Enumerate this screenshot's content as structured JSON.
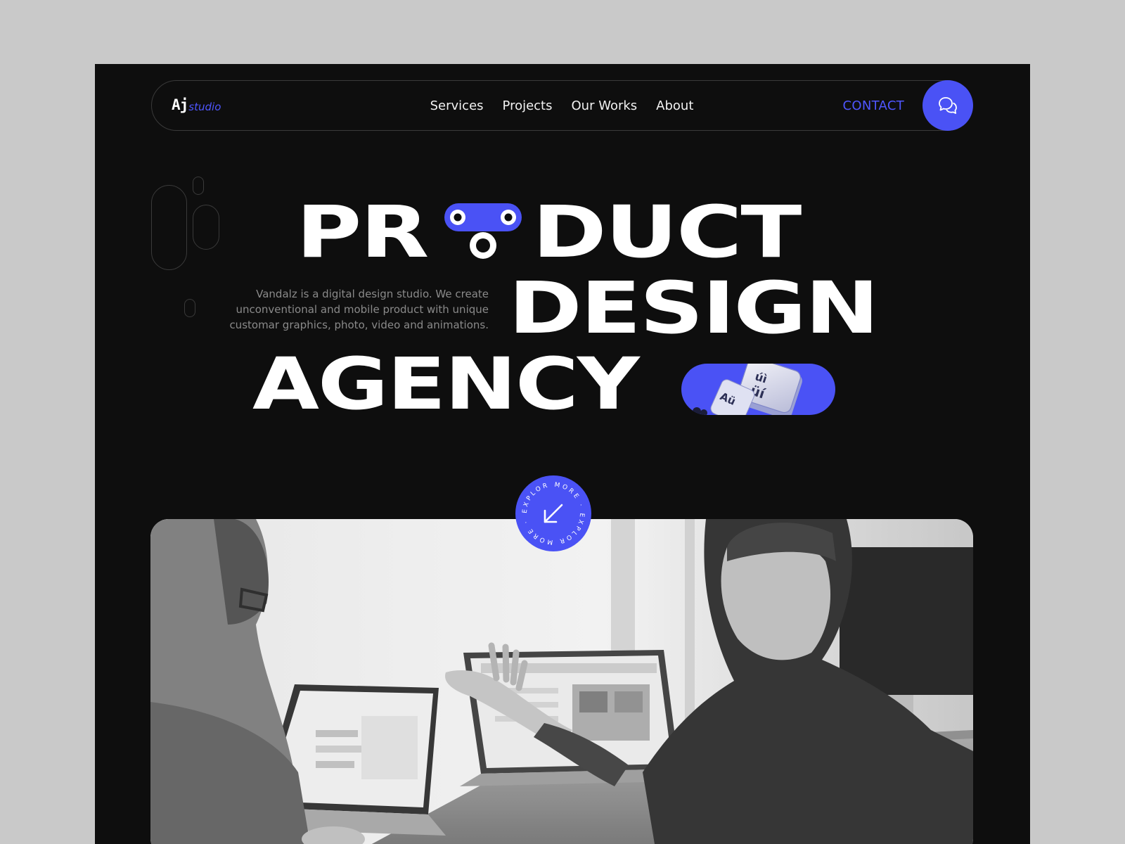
{
  "nav": {
    "logo_mark": "Aj",
    "logo_word": "studio",
    "links": [
      "Services",
      "Projects",
      "Our Works",
      "About"
    ],
    "contact": "CONTACT"
  },
  "hero": {
    "line1_left": "PR",
    "line1_right": "DUCT",
    "line2": "DESIGN",
    "line3": "AGENCY",
    "description": "Vandalz is a digital design studio. We create unconventional and mobile product with unique customar graphics, photo, video and animations."
  },
  "explore": {
    "label": "EXPLOR MORE · EXPLOR MORE · "
  },
  "icons": {
    "chat": "chat-bubbles-icon",
    "arrow": "arrow-down-left-icon"
  },
  "colors": {
    "accent": "#4a52f5",
    "background": "#0e0e0e",
    "page": "#c9c9c9"
  }
}
